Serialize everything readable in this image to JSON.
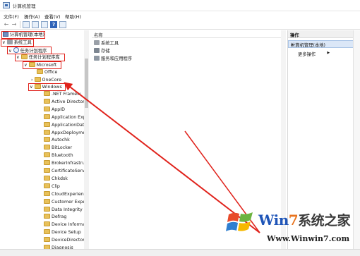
{
  "window": {
    "title": "计算机管理"
  },
  "menu": [
    "文件(F)",
    "操作(A)",
    "查看(V)",
    "帮助(H)"
  ],
  "toolbar": {
    "back": "←",
    "forward": "→",
    "help": "?"
  },
  "tree": {
    "root": "计算机管理(本地)",
    "system_tools": "系统工具",
    "task_scheduler": "任务计划程序",
    "task_scheduler_library": "任务计划程序库",
    "microsoft": "Microsoft",
    "office": "Office",
    "onecore": "OneCore",
    "windows": "Windows",
    "windows_children": [
      ".NET Framew",
      "Active Directory",
      "AppID",
      "Application Exp",
      "ApplicationData",
      "AppxDeployme",
      "Autochk",
      "BitLocker",
      "Bluetooth",
      "BrokerInfrastru",
      "CertificateServi",
      "Chkdsk",
      "Clip",
      "CloudExperienc",
      "Customer Expe",
      "Data Integrity S",
      "Defrag",
      "Device Informa",
      "Device Setup",
      "DeviceDirectory",
      "Diagnosis"
    ]
  },
  "list": {
    "column_name": "名称",
    "items": [
      "系统工具",
      "存储",
      "服务和应用程序"
    ]
  },
  "actions": {
    "header": "操作",
    "section": "计算机管理(本地)",
    "more": "更多操作"
  },
  "watermark": {
    "brand_prefix": "Win",
    "brand_seven": "7",
    "brand_suffix": "系统之家",
    "url": "Www.Winwin7.com"
  },
  "colors": {
    "highlight": "#e0221b",
    "folder": "#e8c15a",
    "selection": "#dbe7f7"
  }
}
